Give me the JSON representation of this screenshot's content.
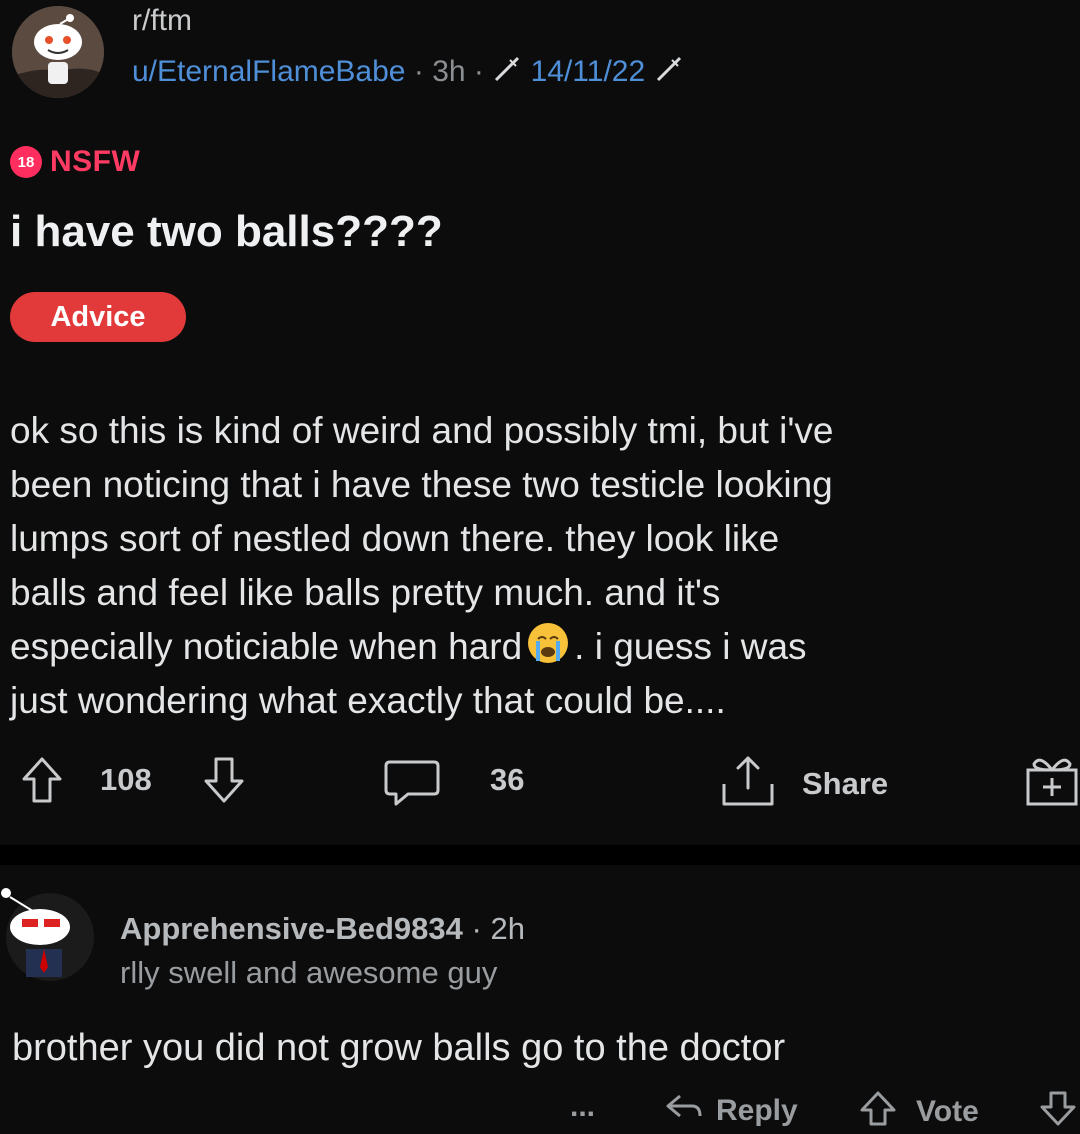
{
  "post": {
    "subreddit": "r/ftm",
    "author": "u/EternalFlameBabe",
    "separator": "·",
    "age": "3h",
    "user_flair": "14/11/22",
    "nsfw_badge": "18",
    "nsfw_label": "NSFW",
    "title": "i have two balls????",
    "post_flair": "Advice",
    "body_lines": [
      "ok so this is kind of weird and possibly tmi, but i've",
      "been noticing that i have these two testicle looking",
      "lumps sort of nestled down there. they look like",
      "balls and feel like balls pretty much. and it's"
    ],
    "body_line5_before": "especially noticiable when hard",
    "body_line5_after": ". i guess i was",
    "body_line6": "just wondering what exactly that could be....",
    "votes": "108",
    "comments": "36",
    "share_label": "Share"
  },
  "comment": {
    "author": "Apprehensive-Bed9834",
    "separator": "·",
    "age": "2h",
    "user_flair": "rlly swell and awesome guy",
    "body": "brother you did not grow balls go to the doctor",
    "more_label": "...",
    "reply_label": "Reply",
    "vote_label": "Vote"
  },
  "colors": {
    "background": "#0c0c0d",
    "username_blue": "#4f8fd8",
    "nsfw_red": "#ff3b64",
    "flair_red": "#e23a3a"
  },
  "icons": [
    "subreddit-avatar-icon",
    "syringe-icon",
    "upvote-icon",
    "downvote-icon",
    "comment-icon",
    "share-icon",
    "award-icon",
    "comment-avatar-icon",
    "reply-icon",
    "vote-icon"
  ]
}
